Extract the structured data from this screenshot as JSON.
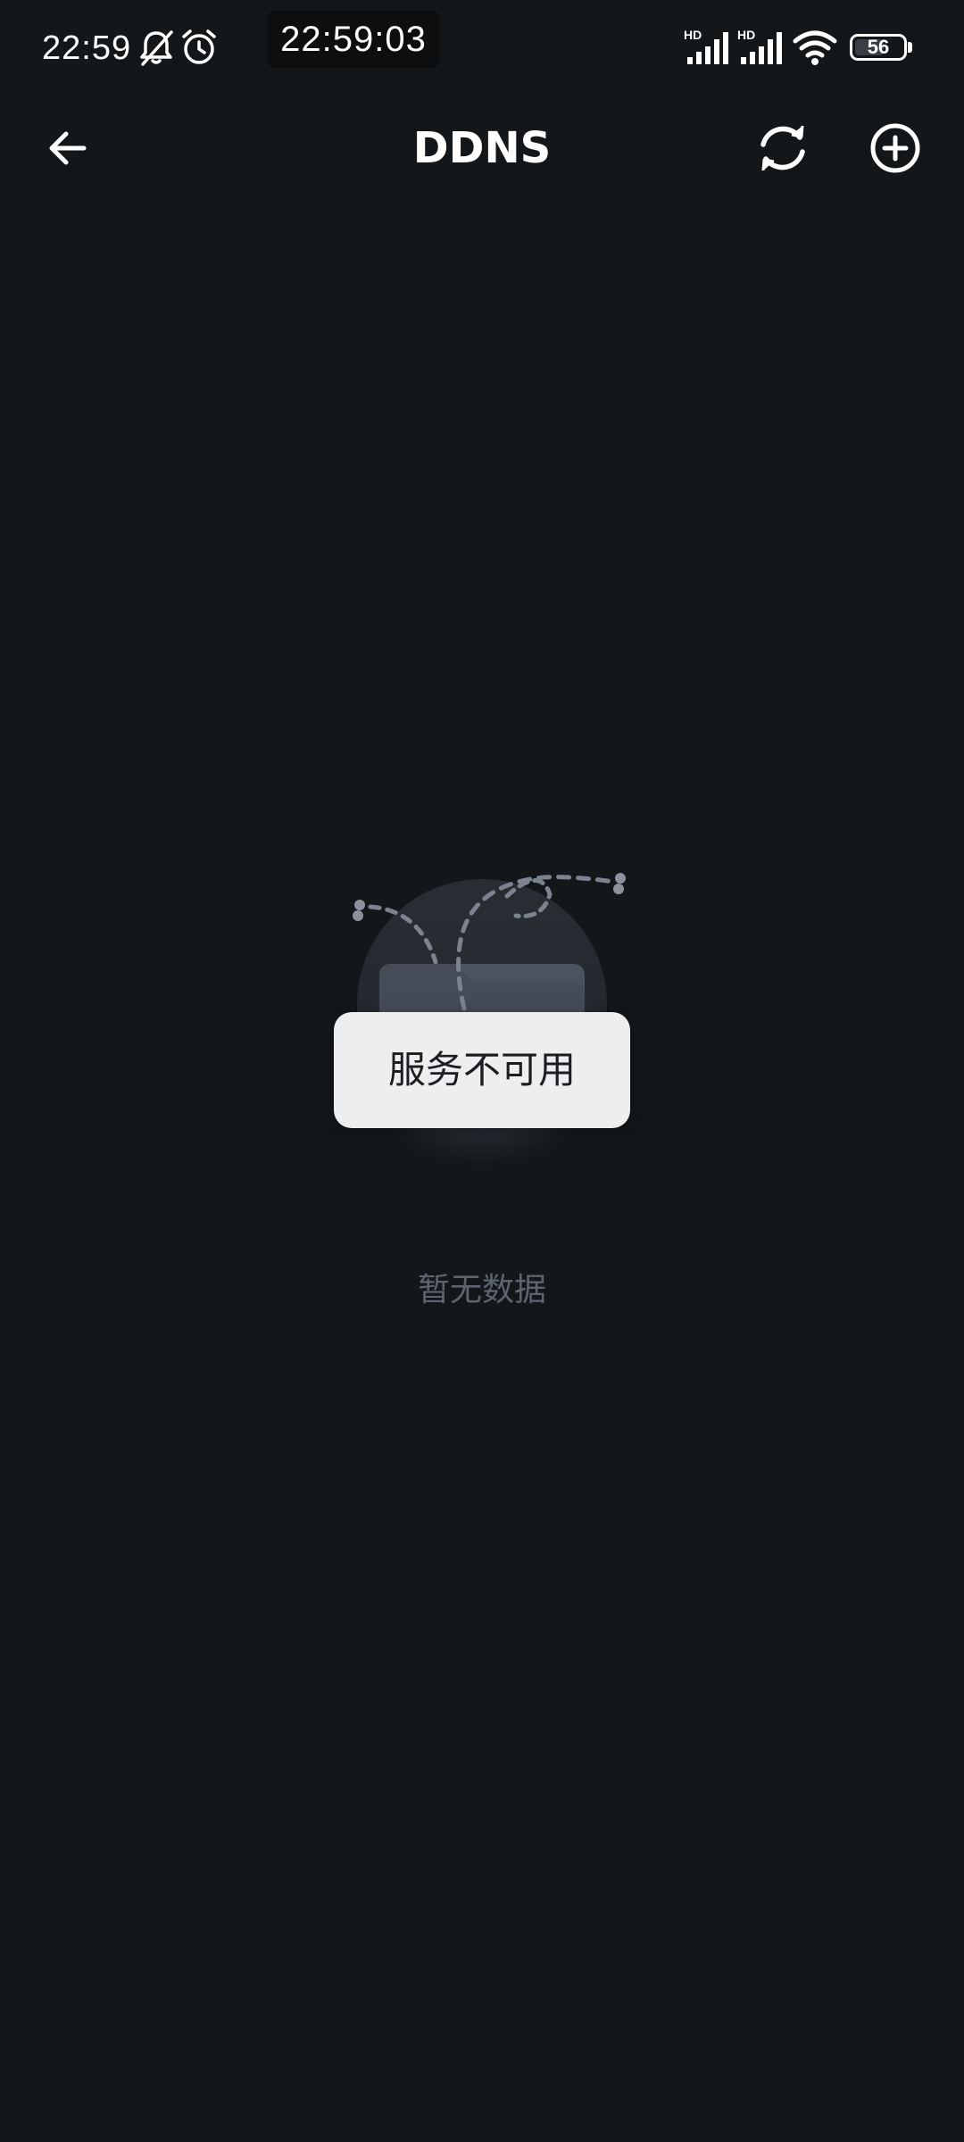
{
  "status_bar": {
    "time": "22:59",
    "overlay_clock": "22:59:03",
    "battery_level": "56",
    "network_labels": [
      "HD",
      "HD"
    ],
    "icons": [
      "bell-off-icon",
      "alarm-icon",
      "signal-icon",
      "signal-icon",
      "wifi-icon",
      "battery-icon"
    ]
  },
  "header": {
    "title": "DDNS",
    "back_icon": "arrow-left-icon",
    "refresh_icon": "refresh-icon",
    "add_icon": "plus-circle-icon"
  },
  "empty_state": {
    "illustration": "empty-folder-illustration",
    "message": "暂无数据"
  },
  "toast": {
    "message": "服务不可用"
  }
}
